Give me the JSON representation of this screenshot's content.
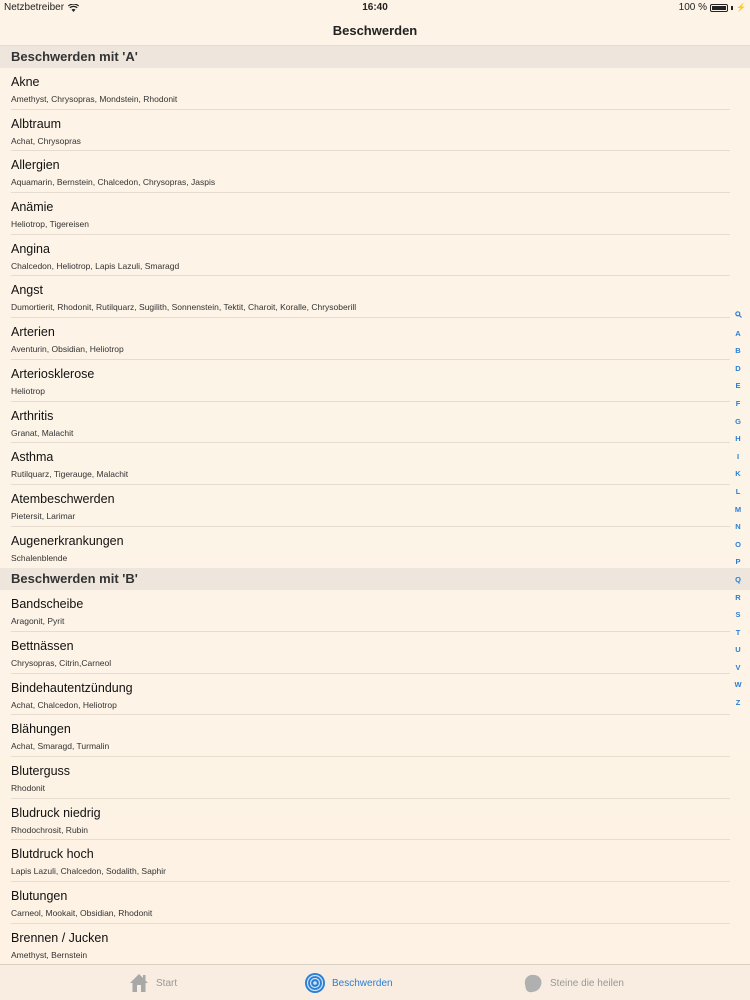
{
  "status": {
    "carrier": "Netzbetreiber",
    "time": "16:40",
    "battery": "100 %"
  },
  "nav": {
    "title": "Beschwerden"
  },
  "sections": [
    {
      "header": "Beschwerden mit 'A'",
      "items": [
        {
          "title": "Akne",
          "sub": "Amethyst, Chrysopras, Mondstein, Rhodonit"
        },
        {
          "title": "Albtraum",
          "sub": "Achat, Chrysopras"
        },
        {
          "title": "Allergien",
          "sub": "Aquamarin, Bernstein, Chalcedon, Chrysopras, Jaspis"
        },
        {
          "title": "Anämie",
          "sub": "Heliotrop, Tigereisen"
        },
        {
          "title": "Angina",
          "sub": "Chalcedon, Heliotrop, Lapis Lazuli, Smaragd"
        },
        {
          "title": "Angst",
          "sub": "Dumortierit, Rhodonit, Rutilquarz, Sugilith, Sonnenstein, Tektit, Charoit, Koralle, Chrysoberill"
        },
        {
          "title": "Arterien",
          "sub": "Aventurin, Obsidian, Heliotrop"
        },
        {
          "title": "Arteriosklerose",
          "sub": "Heliotrop"
        },
        {
          "title": "Arthritis",
          "sub": "Granat, Malachit"
        },
        {
          "title": "Asthma",
          "sub": "Rutilquarz, Tigerauge, Malachit"
        },
        {
          "title": "Atembeschwerden",
          "sub": "Pietersit, Larimar"
        },
        {
          "title": "Augenerkrankungen",
          "sub": "Schalenblende"
        }
      ]
    },
    {
      "header": "Beschwerden mit 'B'",
      "items": [
        {
          "title": "Bandscheibe",
          "sub": "Aragonit, Pyrit"
        },
        {
          "title": "Bettnässen",
          "sub": "Chrysopras, Citrin,Carneol"
        },
        {
          "title": "Bindehautentzündung",
          "sub": "Achat, Chalcedon, Heliotrop"
        },
        {
          "title": "Blähungen",
          "sub": "Achat, Smaragd, Turmalin"
        },
        {
          "title": "Bluterguss",
          "sub": "Rhodonit"
        },
        {
          "title": "Bludruck niedrig",
          "sub": "Rhodochrosit, Rubin"
        },
        {
          "title": "Blutdruck hoch",
          "sub": "Lapis Lazuli, Chalcedon, Sodalith, Saphir"
        },
        {
          "title": "Blutungen",
          "sub": "Carneol, Mookait, Obsidian, Rhodonit"
        },
        {
          "title": "Brennen / Jucken",
          "sub": "Amethyst, Bernstein"
        }
      ]
    }
  ],
  "index": [
    "Q",
    "A",
    "B",
    "D",
    "E",
    "F",
    "G",
    "H",
    "I",
    "K",
    "L",
    "M",
    "N",
    "O",
    "P",
    "Q",
    "R",
    "S",
    "T",
    "U",
    "V",
    "W",
    "Z"
  ],
  "tabs": [
    {
      "label": "Start",
      "icon": "house-icon",
      "active": false
    },
    {
      "label": "Beschwerden",
      "icon": "target-icon",
      "active": true
    },
    {
      "label": "Steine die heilen",
      "icon": "stone-icon",
      "active": false
    }
  ],
  "colors": {
    "accent": "#2a7fd5",
    "background": "#fdf3e6",
    "section": "#eee6dc"
  }
}
